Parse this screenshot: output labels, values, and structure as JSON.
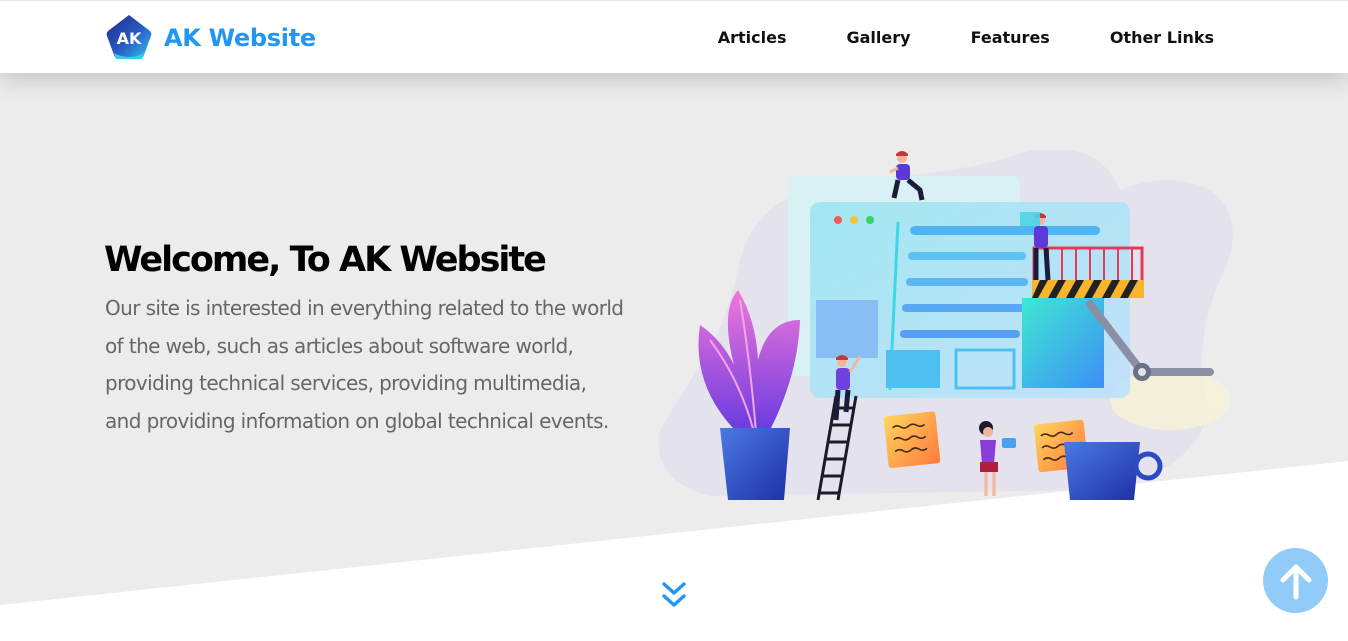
{
  "header": {
    "logo": {
      "mark_text": "AK",
      "site_name": "AK Website"
    },
    "nav": [
      "Articles",
      "Gallery",
      "Features",
      "Other Links"
    ]
  },
  "hero": {
    "title": "Welcome, To AK Website",
    "description": "Our site is interested in everything related to the world of the web, such as articles about software world, providing technical services, providing multimedia, and providing information on global technical events."
  },
  "icons": {
    "scroll_down": "double-chevron-down-icon",
    "back_to_top": "arrow-up-icon"
  },
  "colors": {
    "accent": "#2196f3",
    "hero_bg": "#ececec",
    "back_to_top_bg": "#90cbf9",
    "logo_gradient_start": "#243b9c",
    "logo_gradient_end": "#2ec3e6"
  }
}
